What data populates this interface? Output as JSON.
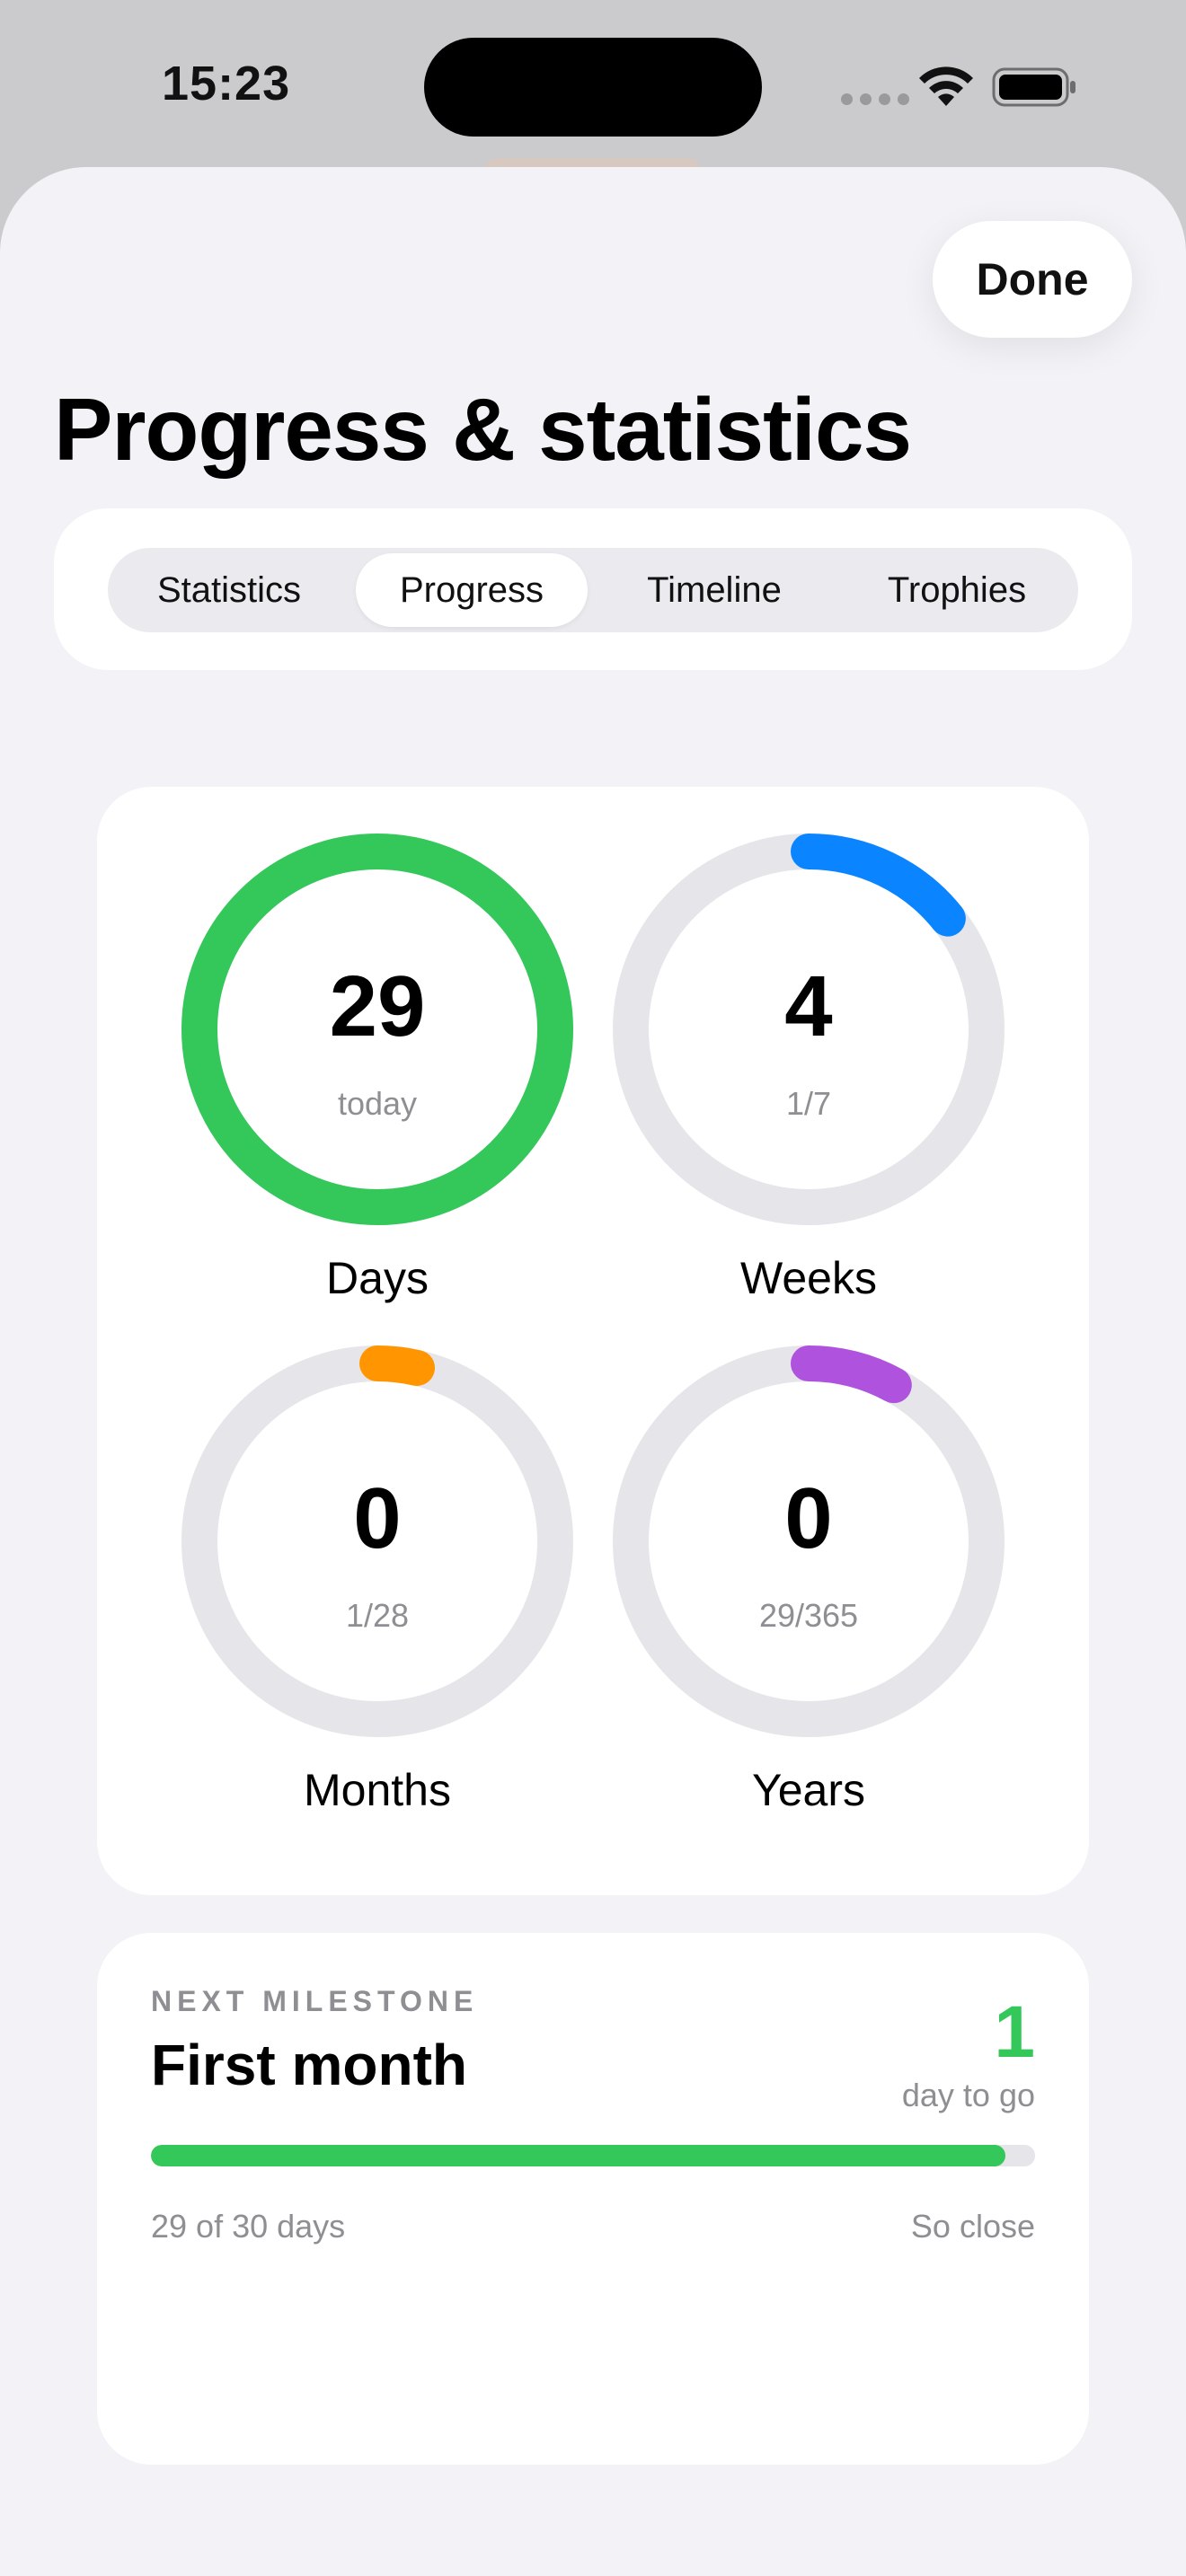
{
  "status_bar": {
    "time": "15:23"
  },
  "header": {
    "done_label": "Done",
    "title": "Progress & statistics"
  },
  "tabs": [
    {
      "label": "Statistics",
      "active": false
    },
    {
      "label": "Progress",
      "active": true
    },
    {
      "label": "Timeline",
      "active": false
    },
    {
      "label": "Trophies",
      "active": false
    }
  ],
  "rings": [
    {
      "label": "Days",
      "value": "29",
      "sub": "today",
      "progress": 1.0,
      "color": "#34c759"
    },
    {
      "label": "Weeks",
      "value": "4",
      "sub": "1/7",
      "progress": 0.142857,
      "color": "#0a84ff"
    },
    {
      "label": "Months",
      "value": "0",
      "sub": "1/28",
      "progress": 0.035714,
      "color": "#ff9500"
    },
    {
      "label": "Years",
      "value": "0",
      "sub": "29/365",
      "progress": 0.079452,
      "color": "#af52de"
    }
  ],
  "colors": {
    "ring_track": "#e5e5ea",
    "accent_green": "#34c759"
  },
  "milestone": {
    "eyebrow": "NEXT MILESTONE",
    "title": "First month",
    "count": "1",
    "count_label": "day to go",
    "progress": 0.966667,
    "footer_left": "29 of 30 days",
    "footer_right": "So close"
  }
}
